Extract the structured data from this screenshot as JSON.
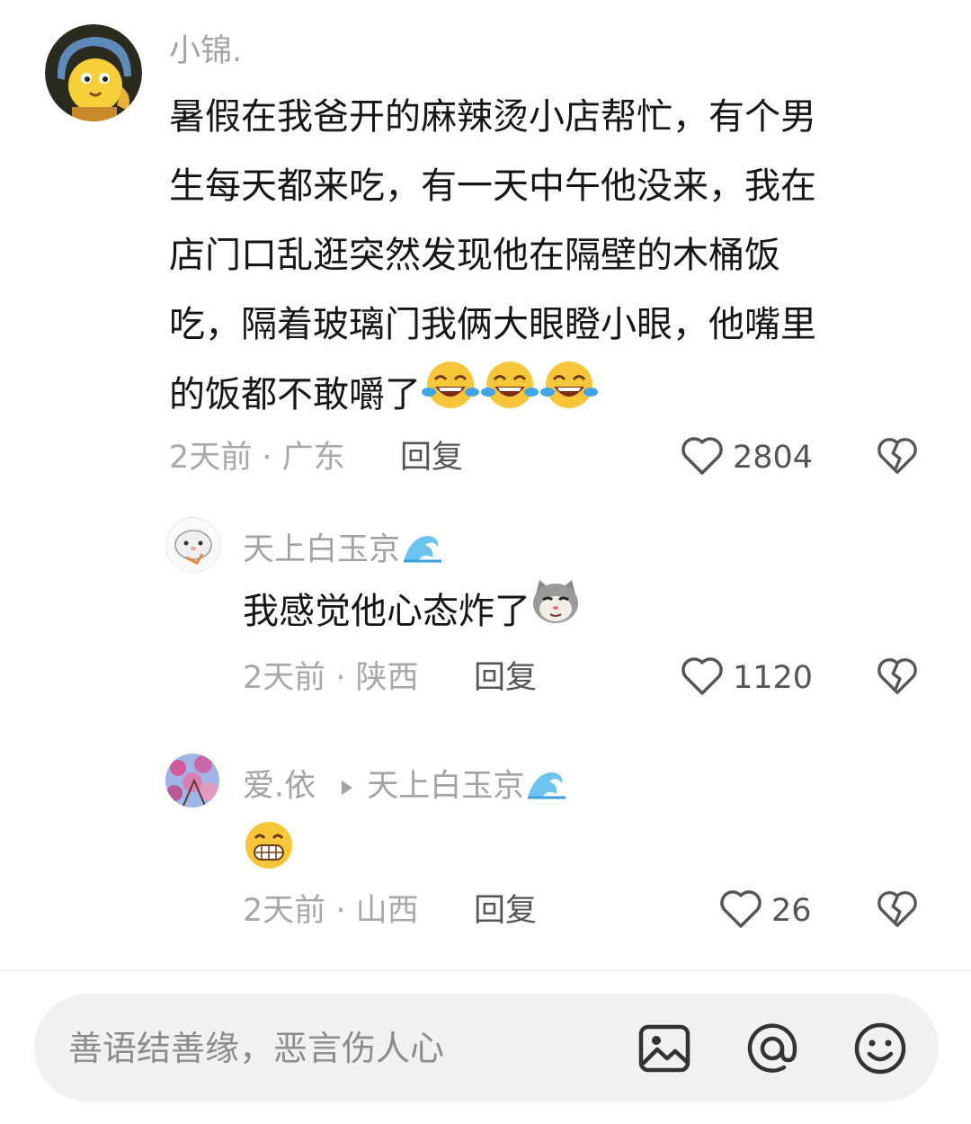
{
  "comments": [
    {
      "username": "小锦.",
      "content_lines": [
        "暑假在我爸开的麻辣烫小店帮忙，有个男",
        "生每天都来吃，有一天中午他没来，我在",
        "店门口乱逛突然发现他在隔壁的木桶饭",
        "吃，隔着玻璃门我俩大眼瞪小眼，他嘴里",
        "的饭都不敢嚼了"
      ],
      "emojis": [
        "laugh-cry-emoji",
        "laugh-cry-emoji",
        "laugh-cry-emoji"
      ],
      "time": "2天前",
      "location": "广东",
      "reply_label": "回复",
      "likes": "2804"
    },
    {
      "username": "天上白玉京",
      "content": "我感觉他心态炸了",
      "emoji": "cat-smirk-emoji",
      "time": "2天前",
      "location": "陕西",
      "reply_label": "回复",
      "likes": "1120"
    },
    {
      "username": "爱.依",
      "reply_to": "天上白玉京",
      "emoji": "grin-emoji",
      "time": "2天前",
      "location": "山西",
      "reply_label": "回复",
      "likes": "26"
    }
  ],
  "separator": " · ",
  "input": {
    "placeholder": "善语结善缘，恶言伤人心",
    "icons": [
      "image-icon",
      "at-icon",
      "emoji-icon"
    ]
  },
  "colors": {
    "text": "#161616",
    "meta": "#a8a8a8",
    "input_bg": "#f1f1f1",
    "emoji_yellow": "#f8c63a"
  }
}
